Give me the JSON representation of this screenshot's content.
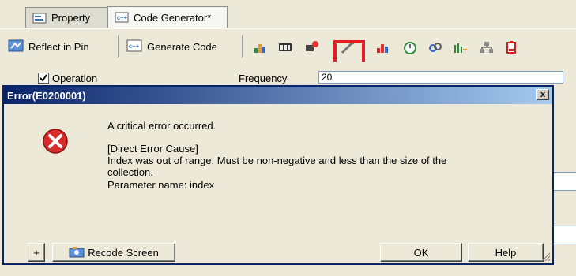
{
  "tabs": [
    {
      "label": "Property",
      "icon": "property-icon"
    },
    {
      "label": "Code Generator*",
      "icon": "code-generator-icon"
    }
  ],
  "toolbar": {
    "reflect_label": "Reflect in Pin",
    "generate_label": "Generate Code",
    "icons": [
      "clock-generator-icon",
      "timer-icon",
      "interrupt-icon",
      "wand-icon",
      "chart-icon",
      "stopwatch-icon",
      "link-icon",
      "serial-icon",
      "network-icon",
      "battery-icon"
    ]
  },
  "background": {
    "operation_label": "Operation",
    "frequency_label": "Frequency",
    "frequency_value": "20"
  },
  "dialog": {
    "title": "Error(E0200001)",
    "line1": "A critical error occurred.",
    "line2": "[Direct Error Cause]",
    "line3": "Index was out of range. Must be non-negative and less than the size of the",
    "line4": "collection.",
    "line5": "Parameter name: index",
    "expand_label": "+",
    "recode_label": "Recode Screen",
    "ok_label": "OK",
    "help_label": "Help",
    "close_label": "x"
  },
  "colors": {
    "highlight": "#e51c23",
    "arrow": "#1a4fd6",
    "title_bar": "#0a246a",
    "error_red": "#d92b2b"
  }
}
